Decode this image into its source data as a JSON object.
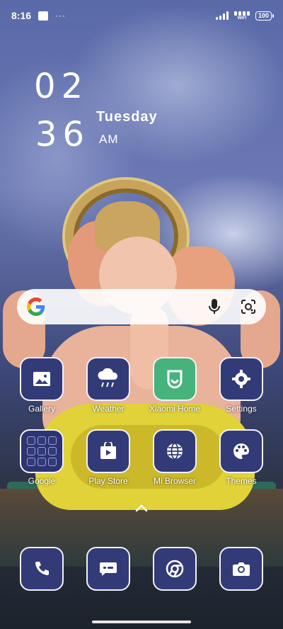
{
  "status_bar": {
    "time": "8:16",
    "overflow": "···",
    "wifi_label": "WIFI",
    "battery": "100"
  },
  "clock_widget": {
    "hour": "02",
    "minute": "36",
    "day": "Tuesday",
    "ampm": "AM"
  },
  "search_bar": {
    "left_icon": "google-g-icon",
    "mic_icon": "mic-icon",
    "lens_icon": "lens-icon"
  },
  "apps_row1": [
    {
      "label": "Gallery",
      "icon": "gallery-icon"
    },
    {
      "label": "Weather",
      "icon": "weather-icon"
    },
    {
      "label": "Xiaomi Home",
      "icon": "xiaomi-home-icon"
    },
    {
      "label": "Settings",
      "icon": "settings-gear-icon"
    }
  ],
  "apps_row2": [
    {
      "label": "Google",
      "icon": "google-folder-icon"
    },
    {
      "label": "Play Store",
      "icon": "play-store-icon"
    },
    {
      "label": "Mi Browser",
      "icon": "globe-icon"
    },
    {
      "label": "Themes",
      "icon": "palette-icon"
    }
  ],
  "dock": [
    {
      "icon": "phone-icon"
    },
    {
      "icon": "messages-icon"
    },
    {
      "icon": "chrome-icon"
    },
    {
      "icon": "camera-icon"
    }
  ],
  "colors": {
    "icon_bg": "#333a78",
    "icon_border": "#f2f2f6",
    "xiaomi_green": "#46b37c"
  }
}
